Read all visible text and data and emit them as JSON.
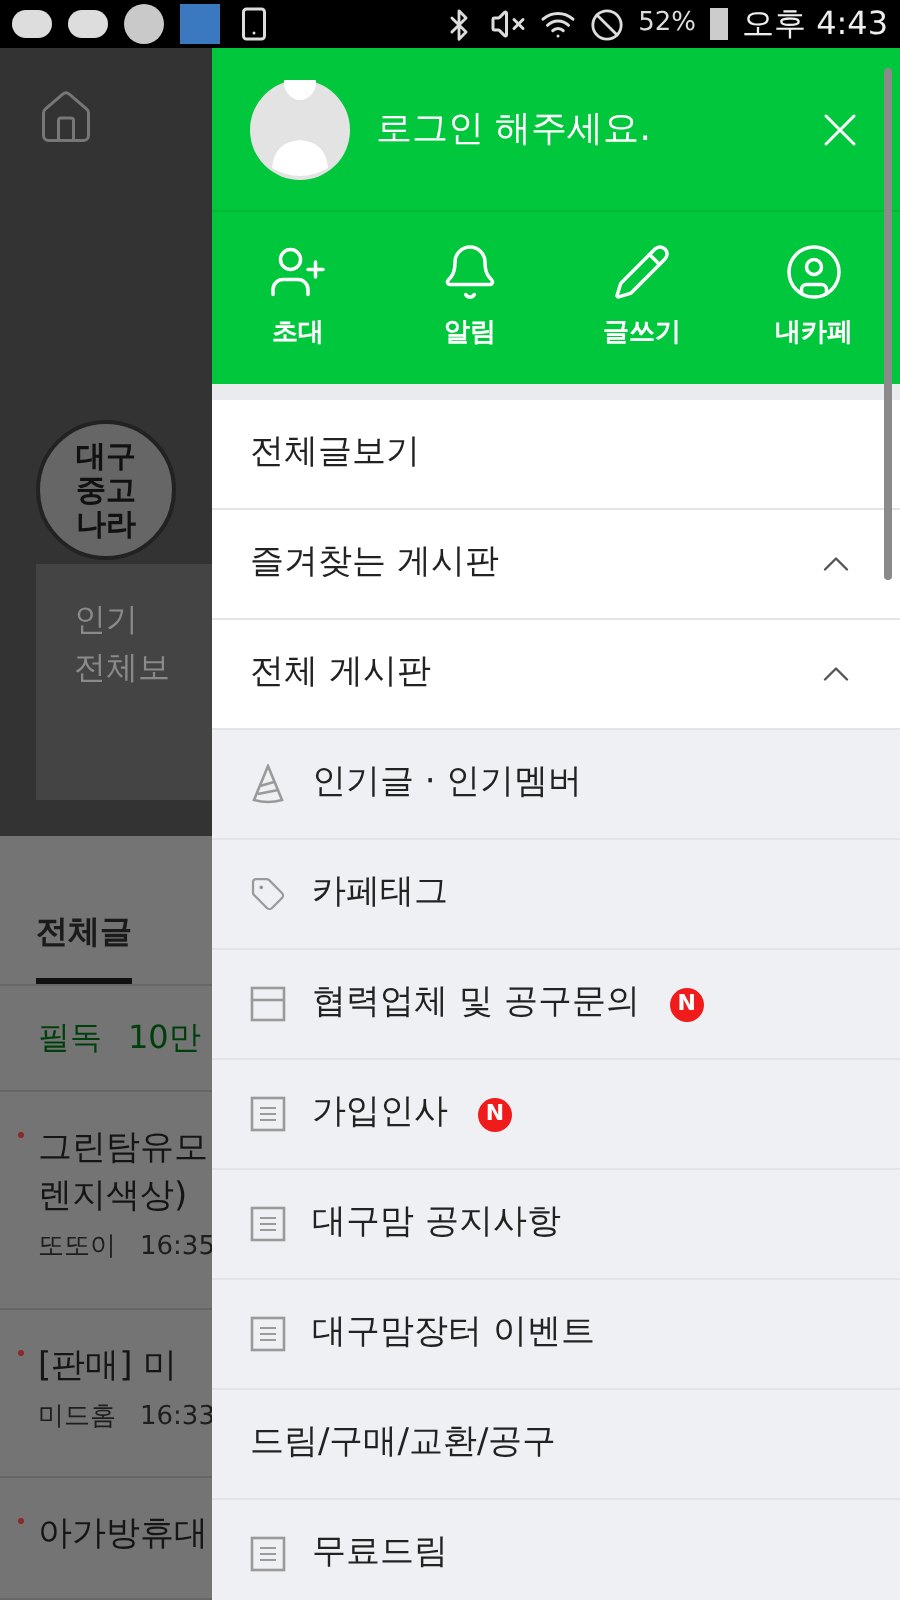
{
  "status_bar": {
    "battery": "52%",
    "time": "오후 4:43"
  },
  "background": {
    "logo_lines": [
      "대구",
      "중고",
      "나라"
    ],
    "popular": [
      "인기",
      "전체보"
    ],
    "tabs": [
      {
        "label": "전체글",
        "selected": true
      }
    ],
    "notice": [
      "필독",
      "10만"
    ],
    "posts": [
      {
        "title_lines": [
          "그린탐유모",
          "렌지색상)"
        ],
        "author": "또또이",
        "time": "16:35"
      },
      {
        "title_lines": [
          "[판매] 미"
        ],
        "author": "미드홈",
        "time": "16:33"
      },
      {
        "title_lines": [
          "아가방휴대"
        ]
      }
    ]
  },
  "drawer": {
    "login_text": "로그인 해주세요.",
    "actions": [
      {
        "kind": "invite",
        "label": "초대"
      },
      {
        "kind": "alarm",
        "label": "알림"
      },
      {
        "kind": "write",
        "label": "글쓰기"
      },
      {
        "kind": "mycafe",
        "label": "내카페"
      }
    ],
    "menu": [
      {
        "kind": "link",
        "label": "전체글보기"
      },
      {
        "kind": "section",
        "label": "즐겨찾는 게시판",
        "expanded": true
      },
      {
        "kind": "section",
        "label": "전체 게시판",
        "expanded": true
      },
      {
        "kind": "popular",
        "label": "인기글 · 인기멤버"
      },
      {
        "kind": "tags",
        "label": "카페태그"
      },
      {
        "kind": "album",
        "label": "협력업체 및 공구문의",
        "badge": "N"
      },
      {
        "kind": "board",
        "label": "가입인사",
        "badge": "N"
      },
      {
        "kind": "board",
        "label": "대구맘 공지사항"
      },
      {
        "kind": "board",
        "label": "대구맘장터 이벤트"
      },
      {
        "kind": "category",
        "label": "드림/구매/교환/공구"
      },
      {
        "kind": "board",
        "label": "무료드림"
      }
    ]
  }
}
